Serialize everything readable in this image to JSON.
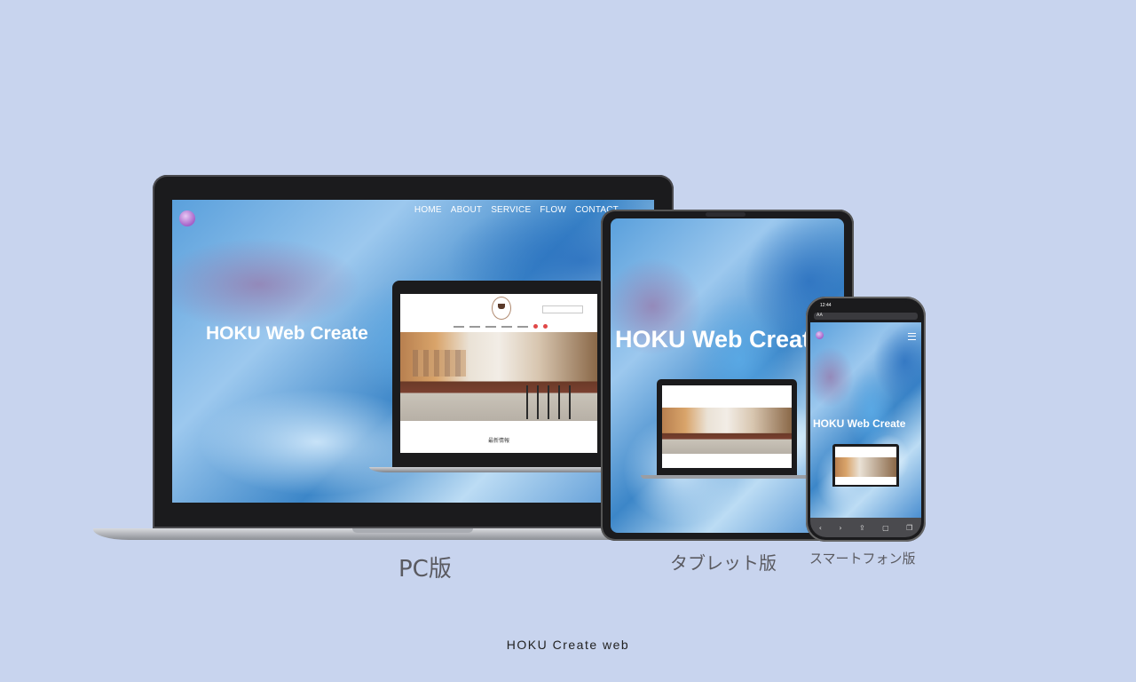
{
  "pc": {
    "nav": [
      "HOME",
      "ABOUT",
      "SERVICE",
      "FLOW",
      "CONTACT"
    ],
    "hero_title": "HOKU Web Create",
    "mini_site_caption": "最新情報"
  },
  "tablet": {
    "hero_title": "HOKU Web Create"
  },
  "smartphone": {
    "status_time": "12:44",
    "url_label": "AA",
    "hero_title": "HOKU Web Create",
    "toolbar_icons": [
      "back-icon",
      "forward-icon",
      "share-icon",
      "bookmarks-icon",
      "tabs-icon"
    ]
  },
  "captions": {
    "pc": "PC版",
    "tablet": "タブレット版",
    "smartphone": "スマートフォン版"
  },
  "footer": "HOKU Create web",
  "colors": {
    "background": "#c8d4ee",
    "device_frame": "#1b1b1d",
    "caption_text": "#5a5a60"
  }
}
